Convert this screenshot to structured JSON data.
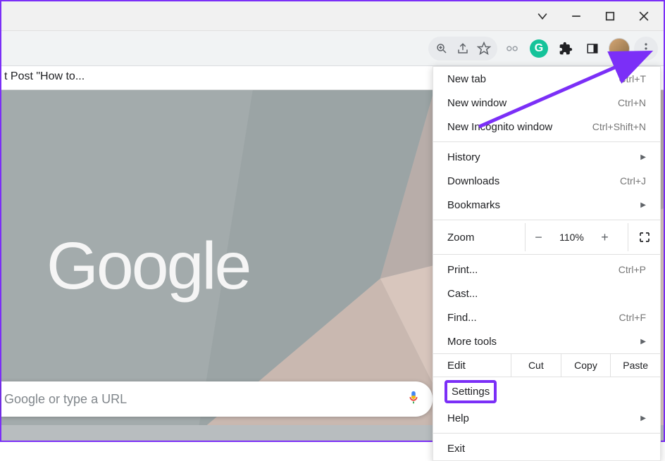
{
  "window": {
    "title_partial": "t Post \"How to..."
  },
  "toolbar": {
    "zoom_icon": "zoom",
    "share_icon": "share",
    "star_icon": "star",
    "extension_loom": "loom",
    "extension_grammarly": "G",
    "extension_puzzle": "extensions",
    "panel_icon": "panel",
    "profile": "avatar",
    "more": "more"
  },
  "search": {
    "placeholder": "Google or type a URL"
  },
  "logo": "Google",
  "menu": {
    "new_tab": {
      "label": "New tab",
      "shortcut": "Ctrl+T"
    },
    "new_window": {
      "label": "New window",
      "shortcut": "Ctrl+N"
    },
    "new_incognito": {
      "label": "New Incognito window",
      "shortcut": "Ctrl+Shift+N"
    },
    "history": {
      "label": "History"
    },
    "downloads": {
      "label": "Downloads",
      "shortcut": "Ctrl+J"
    },
    "bookmarks": {
      "label": "Bookmarks"
    },
    "zoom": {
      "label": "Zoom",
      "value": "110%",
      "minus": "−",
      "plus": "+"
    },
    "print": {
      "label": "Print...",
      "shortcut": "Ctrl+P"
    },
    "cast": {
      "label": "Cast..."
    },
    "find": {
      "label": "Find...",
      "shortcut": "Ctrl+F"
    },
    "more_tools": {
      "label": "More tools"
    },
    "edit": {
      "label": "Edit",
      "cut": "Cut",
      "copy": "Copy",
      "paste": "Paste"
    },
    "settings": {
      "label": "Settings"
    },
    "help": {
      "label": "Help"
    },
    "exit": {
      "label": "Exit"
    }
  }
}
